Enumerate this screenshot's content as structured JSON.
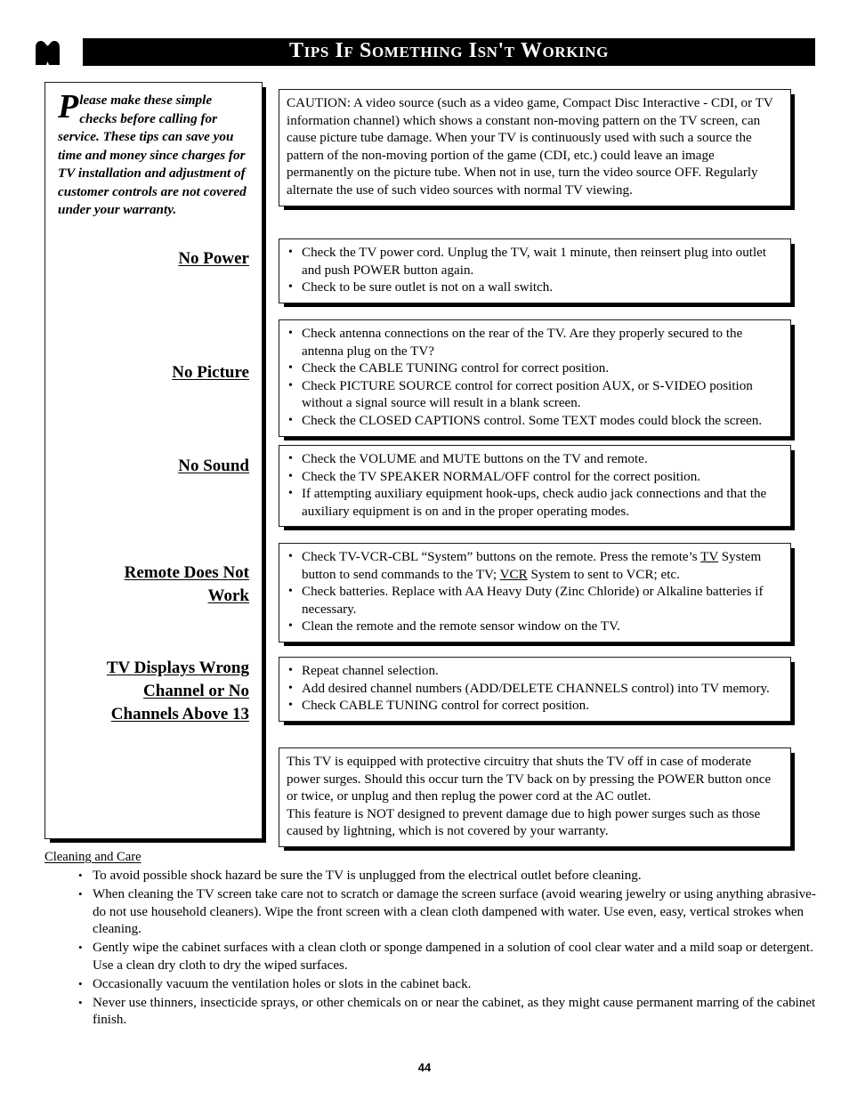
{
  "header": {
    "title": "Tips If Something Isn't Working",
    "logo_icon": "philips-shield-icon"
  },
  "intro": {
    "dropcap": "P",
    "text": "lease make these simple checks before calling for service.  These tips can save you time and money since charges for TV installation and adjustment of customer controls are not covered under your warranty."
  },
  "caution": {
    "text": "CAUTION: A video source (such as a video game, Compact Disc Interactive - CDI, or TV information channel) which shows a constant non-moving pattern on the TV screen, can cause picture tube damage. When your TV is continuously used with such a source the pattern of the non-moving portion of the game (CDI, etc.) could leave an image permanently on the picture tube. When not in use, turn the video source OFF. Regularly alternate the use of such video sources with normal TV viewing."
  },
  "sections": [
    {
      "label": "No Power",
      "label_lines": [
        "No Power"
      ],
      "items": [
        "Check the TV power cord. Unplug the TV, wait 1 minute, then reinsert plug into outlet and push POWER button again.",
        "Check to be sure outlet is not on a wall switch."
      ]
    },
    {
      "label": "No Picture",
      "label_lines": [
        "No Picture"
      ],
      "items": [
        "Check antenna connections on the rear of the TV. Are they properly secured to the antenna plug on the TV?",
        "Check the CABLE TUNING control for correct position.",
        "Check PICTURE SOURCE control for correct position AUX, or S-VIDEO position without a signal source will result in a blank screen.",
        "Check the CLOSED CAPTIONS control. Some TEXT modes could block the screen."
      ]
    },
    {
      "label": "No Sound",
      "label_lines": [
        "No Sound"
      ],
      "items": [
        "Check the VOLUME and MUTE buttons on the TV and remote.",
        "Check the TV SPEAKER NORMAL/OFF control for the correct position.",
        "If attempting auxiliary equipment hook-ups, check audio jack connections and that the auxiliary equipment is on and in the proper operating modes."
      ]
    },
    {
      "label": "Remote Does Not Work",
      "label_lines": [
        "Remote Does Not",
        "Work"
      ],
      "items": [
        "Check TV-VCR-CBL “System” buttons on the remote. Press the remote’s TV System button to send commands to the TV; VCR System to sent to VCR; etc.",
        "Check batteries.  Replace with AA Heavy Duty (Zinc Chloride) or Alkaline batteries if necessary.",
        "Clean the remote and the remote sensor window on the TV."
      ],
      "item_underlined_terms": [
        "TV",
        "VCR"
      ]
    },
    {
      "label": "TV Displays Wrong Channel or No Channels Above 13",
      "label_lines": [
        "TV Displays Wrong",
        "Channel or No",
        "Channels Above 13"
      ],
      "items": [
        "Repeat channel selection.",
        "Add desired channel numbers (ADD/DELETE CHANNELS control) into TV memory.",
        "Check CABLE TUNING control for correct position."
      ]
    }
  ],
  "surge_note": {
    "paragraph_1": "This TV is equipped with protective circuitry that shuts the TV off in case of moderate power surges. Should this occur turn the TV back on by pressing the POWER button once or twice, or unplug and then replug the power cord at the AC outlet.",
    "paragraph_2": "This feature is NOT designed to prevent damage due to high power surges such as those caused by lightning, which is not covered by your warranty."
  },
  "cleaning": {
    "title": "Cleaning and Care",
    "items": [
      "To avoid possible shock hazard be sure the TV is unplugged from the electrical outlet before cleaning.",
      "When cleaning the TV screen take care not to scratch or damage the screen surface (avoid wearing jewelry or using anything abrasive- do not use household cleaners). Wipe the front screen with a clean cloth dampened with water.  Use even, easy, vertical strokes when cleaning.",
      "Gently wipe the cabinet surfaces with a clean cloth or sponge dampened in a solution of cool clear water and a mild soap or detergent. Use a clean dry cloth to dry the wiped surfaces.",
      "Occasionally vacuum the ventilation holes or slots in the cabinet back.",
      "Never use thinners, insecticide sprays, or other chemicals on or near the cabinet, as they might cause permanent marring of the cabinet finish."
    ]
  },
  "footer": {
    "page_number": "44"
  },
  "colors": {
    "ink": "#000000",
    "paper": "#ffffff",
    "banner": "#000000"
  }
}
